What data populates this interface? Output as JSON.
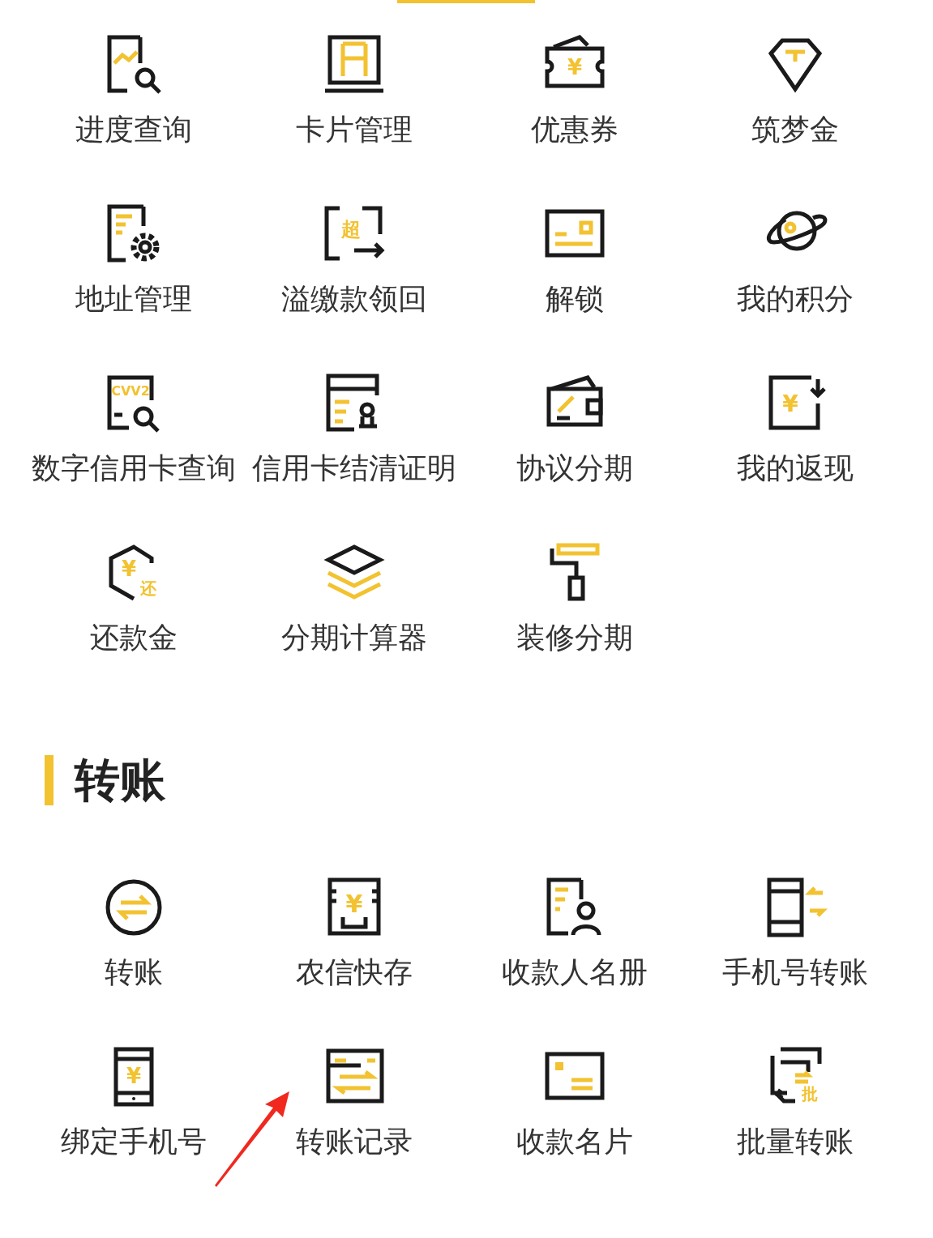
{
  "sections": [
    {
      "items": [
        {
          "label": "进度查询"
        },
        {
          "label": "卡片管理"
        },
        {
          "label": "优惠券",
          "icon_text": [
            "¥"
          ]
        },
        {
          "label": "筑梦金"
        },
        {
          "label": "地址管理"
        },
        {
          "label": "溢缴款领回",
          "icon_text": [
            "超"
          ]
        },
        {
          "label": "解锁"
        },
        {
          "label": "我的积分"
        },
        {
          "label": "数字信用卡查询",
          "icon_text": [
            "CVV2"
          ]
        },
        {
          "label": "信用卡结清证明"
        },
        {
          "label": "协议分期"
        },
        {
          "label": "我的返现",
          "icon_text": [
            "¥"
          ]
        },
        {
          "label": "还款金",
          "icon_text": [
            "¥",
            "还"
          ]
        },
        {
          "label": "分期计算器"
        },
        {
          "label": "装修分期"
        }
      ]
    },
    {
      "title": "转账",
      "items": [
        {
          "label": "转账"
        },
        {
          "label": "农信快存",
          "icon_text": [
            "¥"
          ]
        },
        {
          "label": "收款人名册"
        },
        {
          "label": "手机号转账"
        },
        {
          "label": "绑定手机号",
          "icon_text": [
            "¥"
          ]
        },
        {
          "label": "转账记录",
          "marked": true
        },
        {
          "label": "收款名片"
        },
        {
          "label": "批量转账",
          "icon_text": [
            "批"
          ]
        }
      ]
    }
  ]
}
